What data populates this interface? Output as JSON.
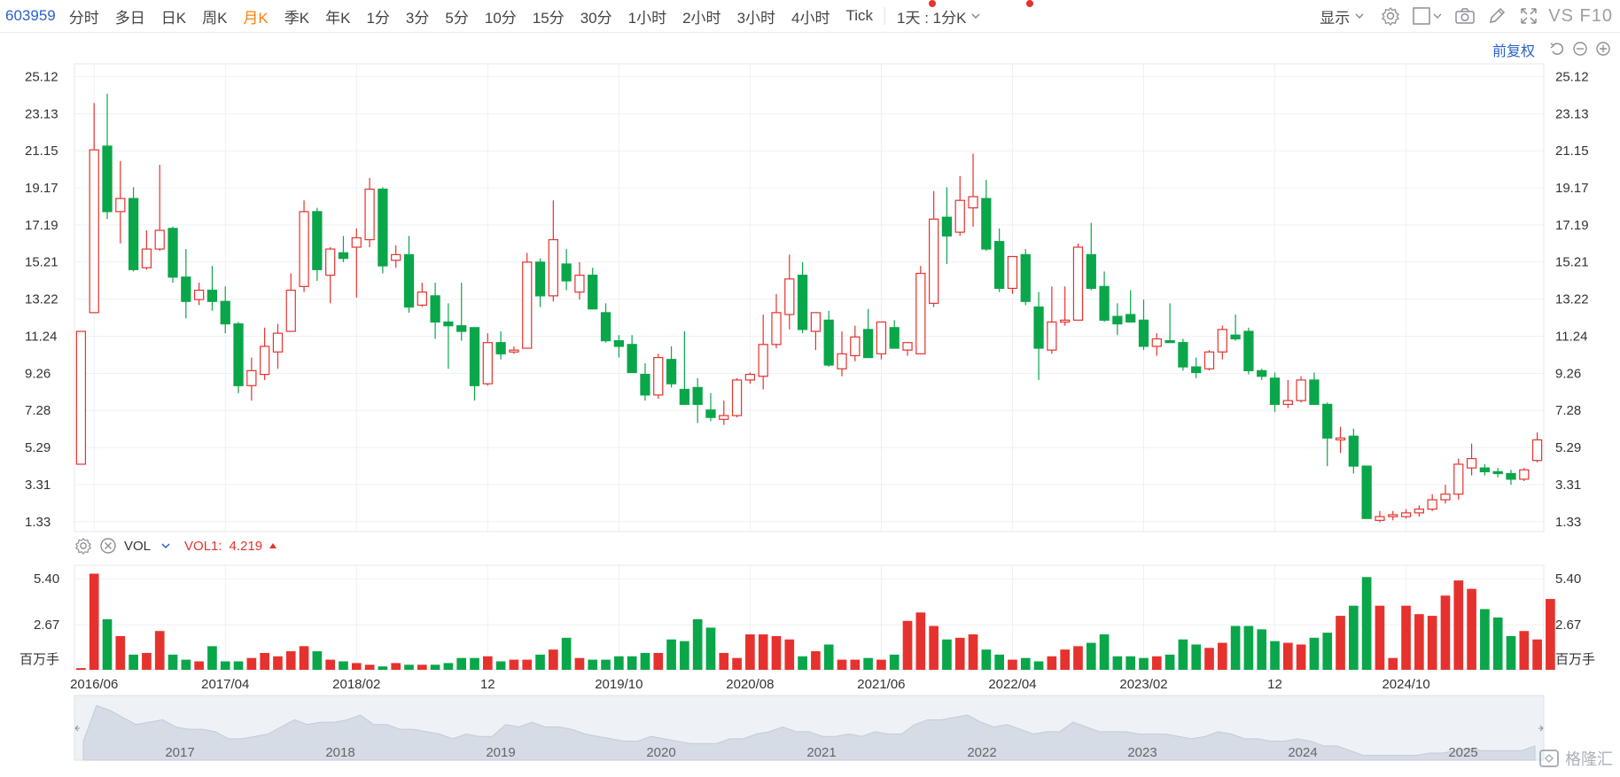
{
  "toolbar": {
    "code": "603959",
    "periods": [
      "分时",
      "多日",
      "日K",
      "周K",
      "月K",
      "季K",
      "年K",
      "1分",
      "3分",
      "5分",
      "10分",
      "15分",
      "30分",
      "1小时",
      "2小时",
      "3小时",
      "4小时",
      "Tick"
    ],
    "active_period": "月K",
    "interval": "1天 : 1分K",
    "show_label": "显示",
    "vs_f10": "VS F10"
  },
  "adjust_label": "前复权",
  "vol_header": {
    "name": "VOL",
    "vol1_label": "VOL1:",
    "vol1_value": "4.219"
  },
  "watermark": "格隆汇",
  "colors": {
    "up": "#e6322e",
    "down": "#0aa64a"
  },
  "chart_data": [
    {
      "type": "candlestick",
      "ylim": [
        0.8,
        25.8
      ],
      "y_ticks": [
        "25.12",
        "23.13",
        "21.15",
        "19.17",
        "17.19",
        "15.21",
        "13.22",
        "11.24",
        "9.26",
        "7.28",
        "5.29",
        "3.31",
        "1.33"
      ],
      "ohlc": [
        [
          4.4,
          11.5,
          4.4,
          11.5
        ],
        [
          12.5,
          23.7,
          12.5,
          21.2
        ],
        [
          21.4,
          24.2,
          17.5,
          17.9
        ],
        [
          17.9,
          20.6,
          16.2,
          18.6
        ],
        [
          18.6,
          19.2,
          14.7,
          14.8
        ],
        [
          14.9,
          16.9,
          14.8,
          15.9
        ],
        [
          15.9,
          20.4,
          15.8,
          16.9
        ],
        [
          17.0,
          17.1,
          14.1,
          14.4
        ],
        [
          14.4,
          15.9,
          12.2,
          13.1
        ],
        [
          13.2,
          14.1,
          12.9,
          13.7
        ],
        [
          13.7,
          15.0,
          12.6,
          13.1
        ],
        [
          13.1,
          13.9,
          11.4,
          11.9
        ],
        [
          11.9,
          12.0,
          8.2,
          8.6
        ],
        [
          8.6,
          10.1,
          7.8,
          9.4
        ],
        [
          9.2,
          11.7,
          8.9,
          10.7
        ],
        [
          10.4,
          11.9,
          9.5,
          11.4
        ],
        [
          11.5,
          14.6,
          11.5,
          13.7
        ],
        [
          13.9,
          18.5,
          13.6,
          17.9
        ],
        [
          17.9,
          18.1,
          14.2,
          14.8
        ],
        [
          14.5,
          16.0,
          13.0,
          15.9
        ],
        [
          15.7,
          16.6,
          15.2,
          15.4
        ],
        [
          16.0,
          17.0,
          13.3,
          16.5
        ],
        [
          16.4,
          19.7,
          16.0,
          19.1
        ],
        [
          19.1,
          19.2,
          14.6,
          15.0
        ],
        [
          15.3,
          16.1,
          14.9,
          15.6
        ],
        [
          15.6,
          16.6,
          12.5,
          12.8
        ],
        [
          12.9,
          14.1,
          12.8,
          13.6
        ],
        [
          13.4,
          14.1,
          11.1,
          12.0
        ],
        [
          12.0,
          13.0,
          9.5,
          11.8
        ],
        [
          11.8,
          14.1,
          11.0,
          11.5
        ],
        [
          11.7,
          11.7,
          7.8,
          8.6
        ],
        [
          8.7,
          11.4,
          8.6,
          10.9
        ],
        [
          10.9,
          11.5,
          10.0,
          10.3
        ],
        [
          10.4,
          10.7,
          10.3,
          10.5
        ],
        [
          10.6,
          15.7,
          10.6,
          15.2
        ],
        [
          15.2,
          15.4,
          12.8,
          13.4
        ],
        [
          13.4,
          18.5,
          13.1,
          16.4
        ],
        [
          15.1,
          15.9,
          13.7,
          14.2
        ],
        [
          13.6,
          15.2,
          13.2,
          14.5
        ],
        [
          14.5,
          14.9,
          12.7,
          12.7
        ],
        [
          12.5,
          13.0,
          10.9,
          11.0
        ],
        [
          11.0,
          11.3,
          10.1,
          10.7
        ],
        [
          10.8,
          11.3,
          9.4,
          9.3
        ],
        [
          9.2,
          9.8,
          7.8,
          8.1
        ],
        [
          8.1,
          10.3,
          7.9,
          10.1
        ],
        [
          10.0,
          10.7,
          8.5,
          8.7
        ],
        [
          8.4,
          11.5,
          7.9,
          7.6
        ],
        [
          8.5,
          9.0,
          6.6,
          7.6
        ],
        [
          7.3,
          8.2,
          6.7,
          6.9
        ],
        [
          6.8,
          7.8,
          6.5,
          7.0
        ],
        [
          7.0,
          9.0,
          6.9,
          8.9
        ],
        [
          8.9,
          9.3,
          8.7,
          9.2
        ],
        [
          9.1,
          12.4,
          8.4,
          10.8
        ],
        [
          10.8,
          13.5,
          10.6,
          12.5
        ],
        [
          12.4,
          15.6,
          11.6,
          14.3
        ],
        [
          14.5,
          15.2,
          11.4,
          11.6
        ],
        [
          11.5,
          12.5,
          10.5,
          12.5
        ],
        [
          12.1,
          12.6,
          9.6,
          9.7
        ],
        [
          9.5,
          11.5,
          9.1,
          10.3
        ],
        [
          10.2,
          11.8,
          9.9,
          11.2
        ],
        [
          11.6,
          12.7,
          10.7,
          10.1
        ],
        [
          10.3,
          12.0,
          10.0,
          12.0
        ],
        [
          11.7,
          12.1,
          10.6,
          10.6
        ],
        [
          10.5,
          10.8,
          10.2,
          10.9
        ],
        [
          10.3,
          15.0,
          10.3,
          14.6
        ],
        [
          13.0,
          19.0,
          12.8,
          17.5
        ],
        [
          17.6,
          19.2,
          15.1,
          16.6
        ],
        [
          16.8,
          19.8,
          16.6,
          18.5
        ],
        [
          18.1,
          21.0,
          17.1,
          18.7
        ],
        [
          18.6,
          19.6,
          15.8,
          15.9
        ],
        [
          16.3,
          17.0,
          13.6,
          13.8
        ],
        [
          13.8,
          15.5,
          13.5,
          15.5
        ],
        [
          15.6,
          15.9,
          12.9,
          13.1
        ],
        [
          12.8,
          13.6,
          8.9,
          10.6
        ],
        [
          10.5,
          13.9,
          10.3,
          12.0
        ],
        [
          12.0,
          13.9,
          11.8,
          12.1
        ],
        [
          12.1,
          16.2,
          12.1,
          16.0
        ],
        [
          15.6,
          17.3,
          13.7,
          13.8
        ],
        [
          13.9,
          14.7,
          12.0,
          12.1
        ],
        [
          12.3,
          13.0,
          11.3,
          11.9
        ],
        [
          12.4,
          13.7,
          12.4,
          12.0
        ],
        [
          12.1,
          13.2,
          10.5,
          10.7
        ],
        [
          10.7,
          11.4,
          10.2,
          11.1
        ],
        [
          11.0,
          13.0,
          10.9,
          10.9
        ],
        [
          10.9,
          11.1,
          9.4,
          9.6
        ],
        [
          9.6,
          10.1,
          9.0,
          9.3
        ],
        [
          9.5,
          10.5,
          9.4,
          10.4
        ],
        [
          10.4,
          11.8,
          10.0,
          11.6
        ],
        [
          11.3,
          12.4,
          11.0,
          11.1
        ],
        [
          11.5,
          11.7,
          9.2,
          9.4
        ],
        [
          9.4,
          9.5,
          8.9,
          9.1
        ],
        [
          9.0,
          9.3,
          7.2,
          7.6
        ],
        [
          7.6,
          8.9,
          7.4,
          7.8
        ],
        [
          7.8,
          9.1,
          7.7,
          8.9
        ],
        [
          8.9,
          9.3,
          7.6,
          7.6
        ],
        [
          7.6,
          7.7,
          4.3,
          5.8
        ],
        [
          5.7,
          6.4,
          5.0,
          5.8
        ],
        [
          5.9,
          6.3,
          3.9,
          4.3
        ],
        [
          4.3,
          4.3,
          1.5,
          1.5
        ],
        [
          1.4,
          1.9,
          1.3,
          1.6
        ],
        [
          1.6,
          1.9,
          1.4,
          1.7
        ],
        [
          1.6,
          2.0,
          1.5,
          1.8
        ],
        [
          1.8,
          2.2,
          1.6,
          2.0
        ],
        [
          2.0,
          2.8,
          1.9,
          2.5
        ],
        [
          2.5,
          3.3,
          2.3,
          2.8
        ],
        [
          2.8,
          4.7,
          2.5,
          4.4
        ],
        [
          4.2,
          5.5,
          3.8,
          4.7
        ],
        [
          4.2,
          4.4,
          3.8,
          4.0
        ],
        [
          4.0,
          4.2,
          3.7,
          3.9
        ],
        [
          3.9,
          4.1,
          3.3,
          3.6
        ],
        [
          3.6,
          4.2,
          3.5,
          4.1
        ],
        [
          4.6,
          6.1,
          4.5,
          5.7
        ]
      ],
      "title": "",
      "xlabel": "",
      "ylabel": ""
    },
    {
      "type": "bar",
      "unit_label": "百万手",
      "ylim": [
        0,
        6.2
      ],
      "y_ticks": [
        "5.40",
        "2.67"
      ],
      "x_tick_labels": [
        "2016/06",
        "2017/04",
        "2018/02",
        "12",
        "2019/10",
        "2020/08",
        "2021/06",
        "2022/04",
        "2023/02",
        "12",
        "2024/10"
      ],
      "values": [
        0.1,
        5.7,
        3.0,
        2.0,
        0.9,
        1.0,
        2.3,
        0.9,
        0.6,
        0.5,
        1.4,
        0.5,
        0.5,
        0.7,
        1.0,
        0.8,
        1.1,
        1.4,
        1.1,
        0.6,
        0.5,
        0.4,
        0.3,
        0.2,
        0.4,
        0.3,
        0.3,
        0.3,
        0.4,
        0.7,
        0.7,
        0.8,
        0.5,
        0.6,
        0.6,
        0.9,
        1.2,
        1.9,
        0.7,
        0.6,
        0.6,
        0.8,
        0.8,
        1.0,
        1.0,
        1.8,
        1.7,
        3.0,
        2.5,
        1.0,
        0.7,
        2.1,
        2.1,
        2.0,
        1.8,
        0.8,
        1.1,
        1.5,
        0.6,
        0.6,
        0.7,
        0.6,
        0.9,
        2.9,
        3.4,
        2.6,
        1.8,
        1.9,
        2.1,
        1.2,
        0.9,
        0.6,
        0.7,
        0.5,
        0.8,
        1.2,
        1.4,
        1.6,
        2.1,
        0.8,
        0.8,
        0.7,
        0.8,
        0.9,
        1.8,
        1.5,
        1.3,
        1.6,
        2.6,
        2.6,
        2.4,
        1.7,
        1.6,
        1.5,
        1.9,
        2.2,
        3.2,
        3.8,
        5.5,
        3.8,
        0.7,
        3.8,
        3.3,
        3.2,
        4.4,
        5.3,
        4.8,
        3.6,
        3.1,
        2.0,
        2.3,
        1.8,
        4.2
      ],
      "title": "",
      "xlabel": "",
      "ylabel": ""
    },
    {
      "type": "area",
      "x_tick_labels": [
        "2017",
        "2018",
        "2019",
        "2020",
        "2021",
        "2022",
        "2023",
        "2024",
        "2025"
      ],
      "values": [
        8,
        23,
        21,
        18,
        15,
        16,
        17,
        14,
        13,
        13,
        12,
        9,
        9,
        10,
        11,
        14,
        17,
        15,
        16,
        16,
        17,
        19,
        15,
        15,
        13,
        13,
        12,
        11,
        9,
        11,
        10,
        10,
        15,
        14,
        16,
        14,
        14,
        13,
        11,
        10,
        9,
        8,
        8,
        10,
        9,
        8,
        7,
        7,
        7,
        9,
        9,
        11,
        12,
        14,
        12,
        12,
        10,
        10,
        11,
        10,
        12,
        11,
        11,
        15,
        17,
        17,
        18,
        19,
        16,
        14,
        15,
        13,
        11,
        12,
        12,
        16,
        14,
        12,
        12,
        12,
        11,
        11,
        11,
        10,
        9,
        10,
        12,
        11,
        9,
        9,
        8,
        8,
        9,
        8,
        6,
        6,
        4,
        2,
        2,
        2,
        2,
        2,
        3,
        3,
        4,
        5,
        4,
        4,
        4,
        4,
        6
      ]
    }
  ]
}
